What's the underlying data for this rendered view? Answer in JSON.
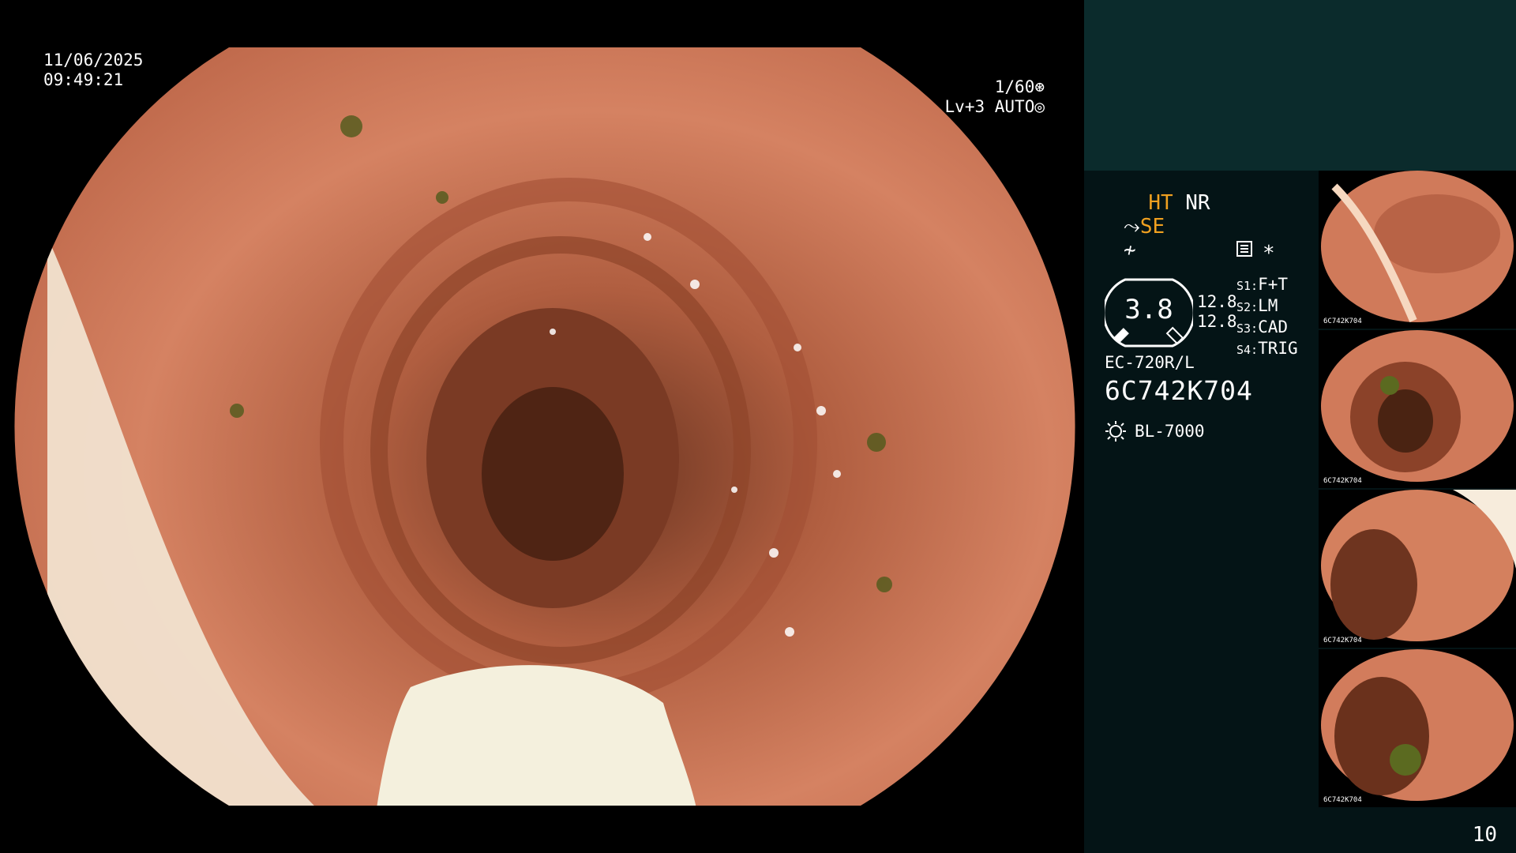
{
  "datetime": {
    "date": "11/06/2025",
    "time": "09:49:21"
  },
  "exposure": {
    "shutter": "1/60",
    "level": "Lv+3",
    "mode": "AUTO"
  },
  "modes": {
    "ht": "HT",
    "nr": "NR",
    "se": "SE"
  },
  "gauge": {
    "value": "3.8",
    "upper": "12.8",
    "lower": "12.8"
  },
  "slots": [
    {
      "key": "S1:",
      "value": "F+T"
    },
    {
      "key": "S2:",
      "value": "LM"
    },
    {
      "key": "S3:",
      "value": "CAD"
    },
    {
      "key": "S4:",
      "value": "TRIG"
    }
  ],
  "scope_model": "EC-720R/L",
  "serial": "6C742K704",
  "light_source": "BL-7000",
  "star_symbol": "*",
  "page_number": "10",
  "thumbnails": [
    {
      "label": "6C742K704"
    },
    {
      "label": "6C742K704"
    },
    {
      "label": "6C742K704"
    },
    {
      "label": "6C742K704"
    }
  ],
  "icons": [
    "aperture-icon",
    "iris-icon",
    "settings-icon",
    "structure-icon",
    "color-icon",
    "lamp-icon"
  ],
  "colors": {
    "panel": "#041416",
    "panel_top": "#0b2b2c",
    "accent": "#f0a020",
    "tissue": "#c86a48"
  }
}
